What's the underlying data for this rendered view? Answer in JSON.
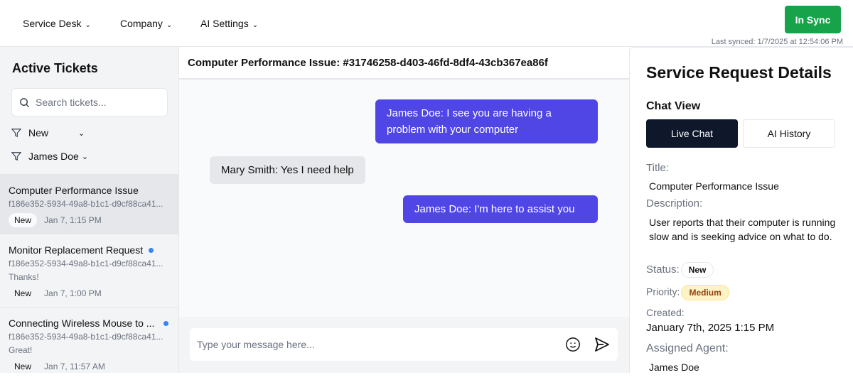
{
  "nav": {
    "items": [
      {
        "label": "Service Desk"
      },
      {
        "label": "Company"
      },
      {
        "label": "AI Settings"
      }
    ],
    "sync_button": "In Sync",
    "last_synced": "Last synced: 1/7/2025 at 12:54:06 PM"
  },
  "sidebar": {
    "title": "Active Tickets",
    "search_placeholder": "Search tickets...",
    "filters": [
      {
        "label": "New"
      },
      {
        "label": "James Doe"
      }
    ],
    "tickets": [
      {
        "title": "Computer Performance Issue",
        "id": "f186e352-5934-49a8-b1c1-d9cf88ca41...",
        "last_message": "",
        "status": "New",
        "time": "Jan 7, 1:15 PM",
        "unread": false,
        "selected": true
      },
      {
        "title": "Monitor Replacement Request",
        "id": "f186e352-5934-49a8-b1c1-d9cf88ca41...",
        "last_message": "Thanks!",
        "status": "New",
        "time": "Jan 7, 1:00 PM",
        "unread": true,
        "selected": false
      },
      {
        "title": "Connecting Wireless Mouse to ...",
        "id": "f186e352-5934-49a8-b1c1-d9cf88ca41...",
        "last_message": "Great!",
        "status": "New",
        "time": "Jan 7, 11:57 AM",
        "unread": true,
        "selected": false
      }
    ]
  },
  "chat": {
    "title": "Computer Performance Issue: #31746258-d403-46fd-8df4-43cb367ea86f",
    "messages": [
      {
        "text": "James Doe: I see you are having a problem with your computer",
        "from": "agent"
      },
      {
        "text": "Mary Smith: Yes I need help",
        "from": "user"
      },
      {
        "text": "James Doe: I'm here to assist you",
        "from": "agent"
      }
    ],
    "input_placeholder": "Type your message here..."
  },
  "details": {
    "title": "Service Request Details",
    "chat_view_label": "Chat View",
    "tabs": [
      {
        "label": "Live Chat",
        "active": true
      },
      {
        "label": "AI History",
        "active": false
      }
    ],
    "title_label": "Title:",
    "title_value": "Computer Performance Issue",
    "description_label": "Description:",
    "description_value": "User reports that their computer is running slow and is seeking advice on what to do.",
    "status_label": "Status:",
    "status_value": "New",
    "priority_label": "Priority:",
    "priority_value": "Medium",
    "created_label": "Created:",
    "created_value": "January 7th, 2025 1:15 PM",
    "agent_label": "Assigned Agent:",
    "agent_value": "James Doe"
  },
  "colors": {
    "accent": "#4f46e5",
    "sync": "#16a34a",
    "unread_dot": "#3b82f6",
    "priority_bg": "#fef3c7"
  }
}
